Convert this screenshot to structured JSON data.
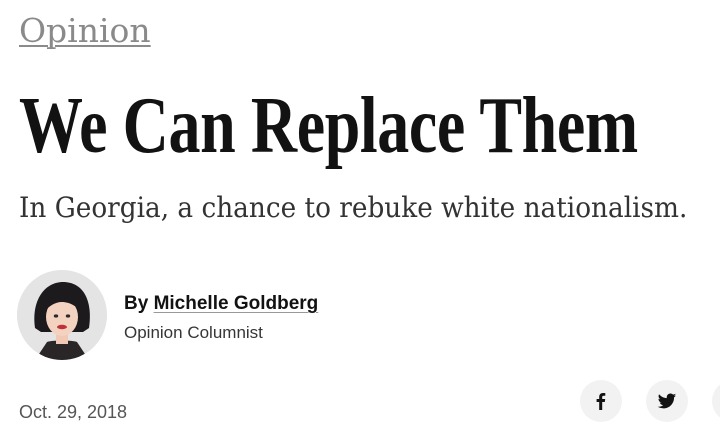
{
  "section": {
    "label": "Opinion"
  },
  "article": {
    "headline": "We Can Replace Them",
    "summary": "In Georgia, a chance to rebuke white nationalism.",
    "byline_prefix": "By ",
    "author_name": "Michelle Goldberg",
    "author_role": "Opinion Columnist",
    "date": "Oct. 29, 2018"
  },
  "share": {
    "facebook_icon": "facebook-icon",
    "twitter_icon": "twitter-icon"
  },
  "colors": {
    "headline": "#121212",
    "section_link": "#8a8a8a",
    "share_button_bg": "#f2f2f2"
  }
}
